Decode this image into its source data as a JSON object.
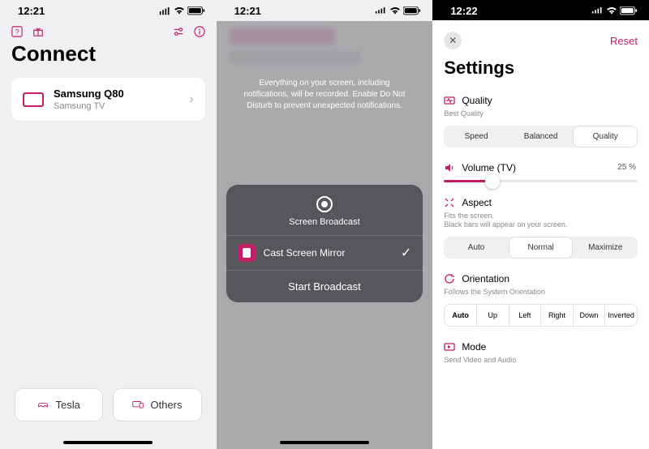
{
  "status": {
    "time_a": "12:21",
    "time_b": "12:21",
    "time_c": "12:22"
  },
  "screen1": {
    "title": "Connect",
    "device": {
      "name": "Samsung Q80",
      "sub": "Samsung TV"
    },
    "buttons": {
      "a": "Tesla",
      "b": "Others"
    }
  },
  "screen2": {
    "warning": "Everything on your screen, including notifications, will be recorded. Enable Do Not Disturb to prevent unexpected notifications.",
    "sheet_title": "Screen Broadcast",
    "app_name": "Cast Screen Mirror",
    "start": "Start Broadcast"
  },
  "screen3": {
    "reset": "Reset",
    "title": "Settings",
    "quality": {
      "label": "Quality",
      "sub": "Best Quality",
      "opts": [
        "Speed",
        "Balanced",
        "Quality"
      ]
    },
    "volume": {
      "label": "Volume (TV)",
      "value": "25 %",
      "pct": 25
    },
    "aspect": {
      "label": "Aspect",
      "sub1": "Fits the screen.",
      "sub2": "Black bars will appear on your screen.",
      "opts": [
        "Auto",
        "Normal",
        "Maximize"
      ]
    },
    "orientation": {
      "label": "Orientation",
      "sub": "Follows the System Orientation",
      "opts": [
        "Auto",
        "Up",
        "Left",
        "Right",
        "Down",
        "Inverted"
      ]
    },
    "mode": {
      "label": "Mode",
      "sub": "Send Video and Audio"
    }
  }
}
